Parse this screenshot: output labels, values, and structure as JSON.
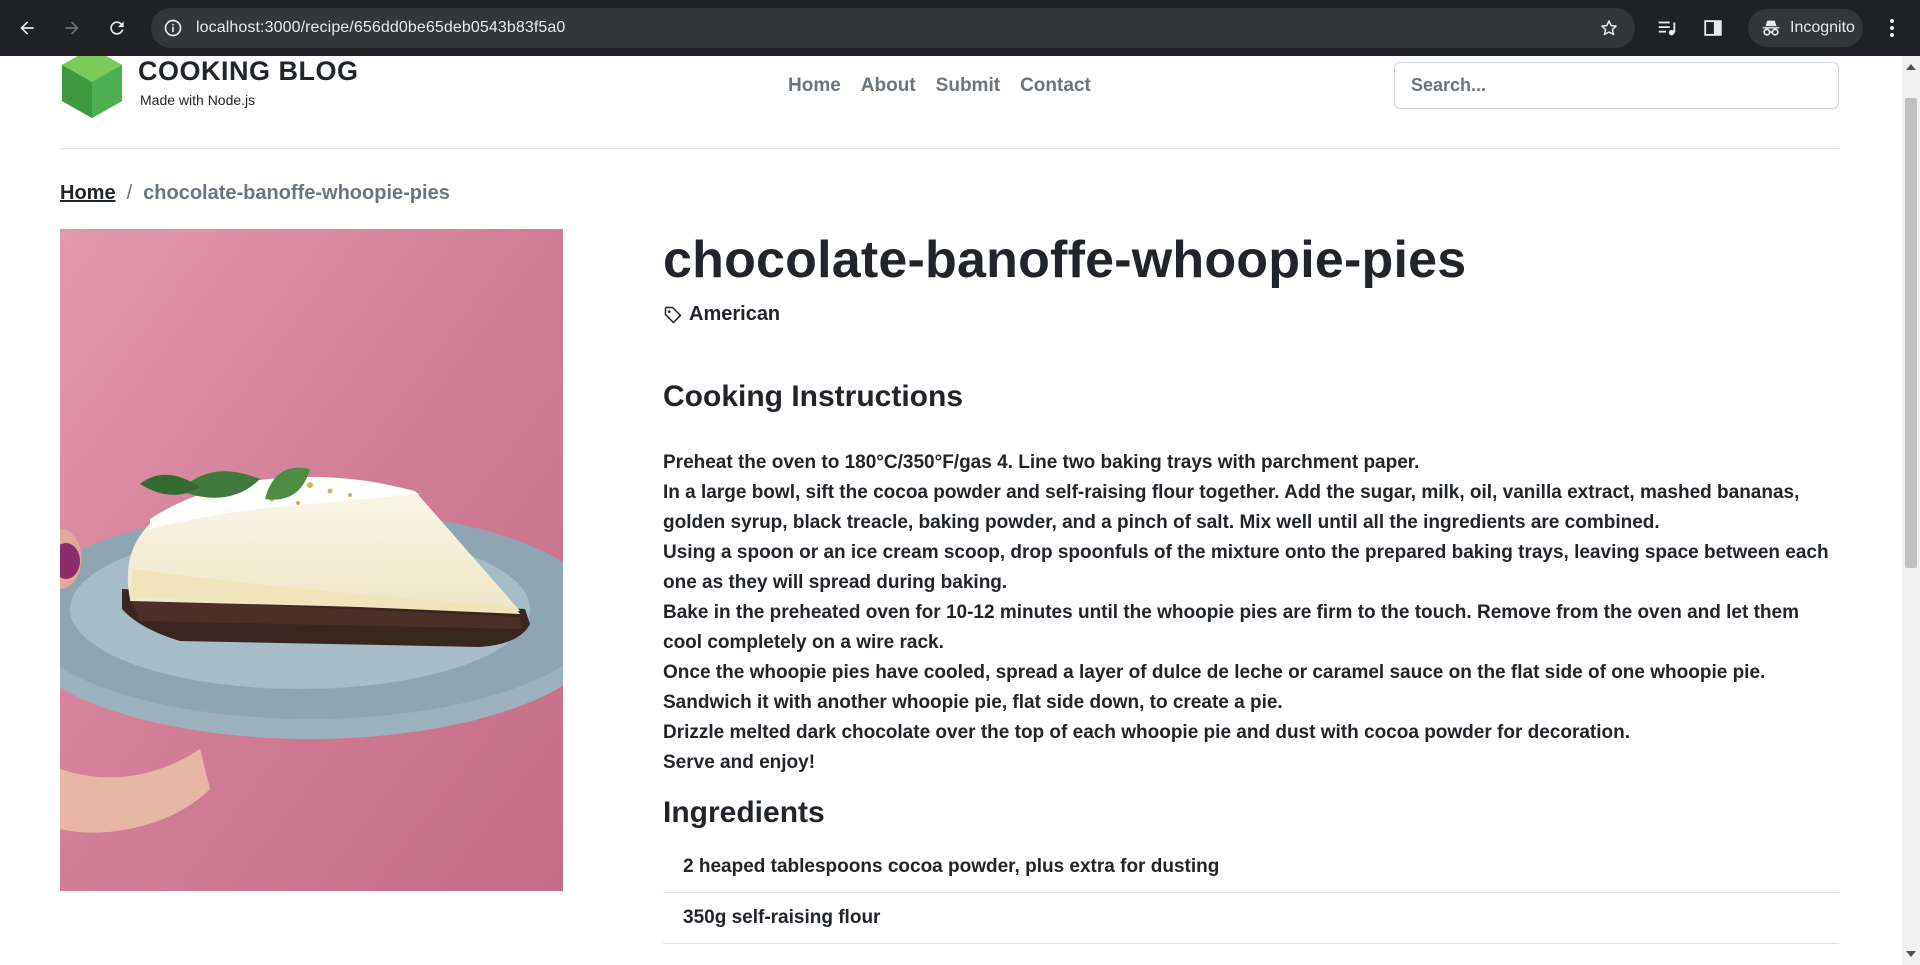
{
  "browser": {
    "url": "localhost:3000/recipe/656dd0be65deb0543b83f5a0",
    "profile_label": "Incognito"
  },
  "site": {
    "title": "COOKING BLOG",
    "subtitle": "Made with Node.js",
    "nav": [
      "Home",
      "About",
      "Submit",
      "Contact"
    ],
    "search_placeholder": "Search..."
  },
  "breadcrumb": {
    "home": "Home",
    "separator": "/",
    "current": "chocolate-banoffe-whoopie-pies"
  },
  "recipe": {
    "title": "chocolate-banoffe-whoopie-pies",
    "category": "American",
    "instructions_heading": "Cooking Instructions",
    "instructions": [
      "Preheat the oven to 180°C/350°F/gas 4. Line two baking trays with parchment paper.",
      "In a large bowl, sift the cocoa powder and self-raising flour together. Add the sugar, milk, oil, vanilla extract, mashed bananas, golden syrup, black treacle, baking powder, and a pinch of salt. Mix well until all the ingredients are combined.",
      "Using a spoon or an ice cream scoop, drop spoonfuls of the mixture onto the prepared baking trays, leaving space between each one as they will spread during baking.",
      "Bake in the preheated oven for 10-12 minutes until the whoopie pies are firm to the touch. Remove from the oven and let them cool completely on a wire rack.",
      "Once the whoopie pies have cooled, spread a layer of dulce de leche or caramel sauce on the flat side of one whoopie pie. Sandwich it with another whoopie pie, flat side down, to create a pie.",
      "Drizzle melted dark chocolate over the top of each whoopie pie and dust with cocoa powder for decoration.",
      "Serve and enjoy!"
    ],
    "ingredients_heading": "Ingredients",
    "ingredients": [
      "2 heaped tablespoons cocoa powder, plus extra for dusting",
      "350g self-raising flour"
    ]
  },
  "colors": {
    "chrome_bg": "#202124",
    "omnibox_bg": "#35363a",
    "text": "#212529",
    "muted": "#6c757d",
    "logo_green": "#4caf50",
    "hero_pink": "#d07a95"
  },
  "icons": {
    "back": "arrow-left-icon",
    "forward": "arrow-right-icon",
    "reload": "reload-icon",
    "site_info": "info-icon",
    "bookmark": "star-icon",
    "media": "media-controls-icon",
    "side_panel": "side-panel-icon",
    "incognito": "incognito-icon",
    "menu": "kebab-menu-icon",
    "tag": "tag-icon"
  }
}
